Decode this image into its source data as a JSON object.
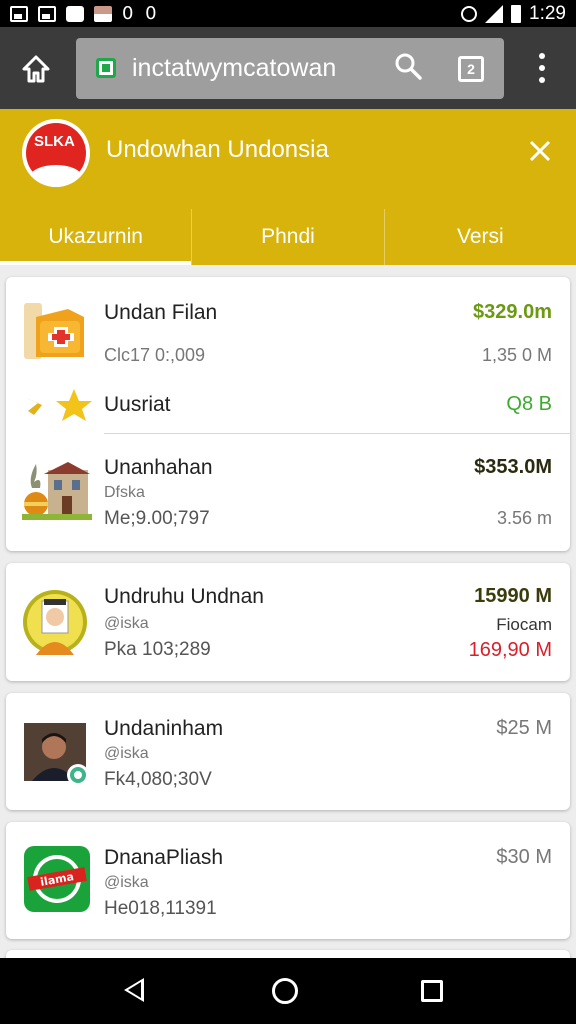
{
  "status_bar": {
    "left_text": "0 0",
    "time": "1:29"
  },
  "browser": {
    "url": "inctatwymcatowan",
    "tab_count": "2"
  },
  "app_header": {
    "title": "Undowhan Undonsia",
    "logo_text": "SLKA",
    "tabs": [
      {
        "label": "Ukazurnin",
        "active": true
      },
      {
        "label": "Phndi",
        "active": false
      },
      {
        "label": "Versi",
        "active": false
      }
    ]
  },
  "cards": [
    {
      "rows": [
        {
          "name": "Undan Filan",
          "meta": "Clc17 0:,009",
          "amount": "$329.0m",
          "amount2": "1,35 0 M"
        },
        {
          "name": "Uusriat",
          "amount": "Q8 B"
        },
        {
          "name": "Unanhahan",
          "sub": "Dfska",
          "meta": "Me;9.00;797",
          "amount": "$353.0M",
          "amount2": "3.56 m"
        }
      ]
    },
    {
      "name": "Undruhu Undnan",
      "sub": "@iska",
      "meta": "Pka 103;289",
      "amount": "15990 M",
      "amount_mid": "Fiocam",
      "amount2": "169,90 M"
    },
    {
      "name": "Undaninham",
      "sub": "@iska",
      "meta": "Fk4,080;30V",
      "amount": "$25 M"
    },
    {
      "name": "DnanaPliash",
      "sub": "@iska",
      "meta": "He018,11391",
      "amount": "$30 M"
    }
  ],
  "colors": {
    "header": "#d8b30b",
    "browser_bar": "#3b3b3b",
    "green_amount": "#6b9a12",
    "red_amount": "#d8202a"
  },
  "icons": [
    "home-icon",
    "lock-icon",
    "search-icon",
    "tabs-icon",
    "more-icon",
    "close-icon",
    "back-icon",
    "home-nav-icon",
    "recent-apps-icon"
  ]
}
